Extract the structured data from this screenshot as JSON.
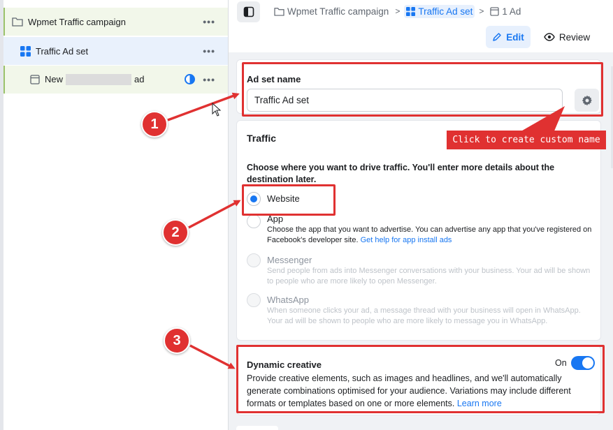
{
  "tree": {
    "campaign": "Wpmet Traffic campaign",
    "adset": "Traffic Ad set",
    "ad_prefix": "New",
    "ad_suffix": "ad",
    "more": "•••"
  },
  "breadcrumb": {
    "campaign": "Wpmet Traffic campaign",
    "adset": "Traffic Ad set",
    "ad": "1 Ad",
    "separator": ">"
  },
  "actions": {
    "edit": "Edit",
    "review": "Review"
  },
  "adset_name": {
    "label": "Ad set name",
    "value": "Traffic Ad set"
  },
  "traffic": {
    "title": "Traffic",
    "prompt": "Choose where you want to drive traffic. You'll enter more details about the destination later.",
    "options": [
      {
        "title": "Website",
        "desc": "",
        "selected": true
      },
      {
        "title": "App",
        "desc": "Choose the app that you want to advertise. You can advertise any app that you've registered on Facebook's developer site.",
        "link": "Get help for app install ads"
      },
      {
        "title": "Messenger",
        "desc": "Send people from ads into Messenger conversations with your business. Your ad will be shown to people who are more likely to open Messenger."
      },
      {
        "title": "WhatsApp",
        "desc": "When someone clicks your ad, a message thread with your business will open in WhatsApp. Your ad will be shown to people who are more likely to message you in WhatsApp."
      }
    ]
  },
  "dynamic": {
    "title": "Dynamic creative",
    "state": "On",
    "desc": "Provide creative elements, such as images and headlines, and we'll automatically generate combinations optimised for your audience. Variations may include different formats or templates based on one or more elements.",
    "link": "Learn more"
  },
  "annotations": {
    "badge_1": "1",
    "badge_2": "2",
    "badge_3": "3",
    "callout": "Click to create custom name",
    "color": "#e03131"
  },
  "colors": {
    "accent": "#1877f2",
    "campaign_bg": "#f2f7ea",
    "adset_bg": "#e9f1fc"
  }
}
